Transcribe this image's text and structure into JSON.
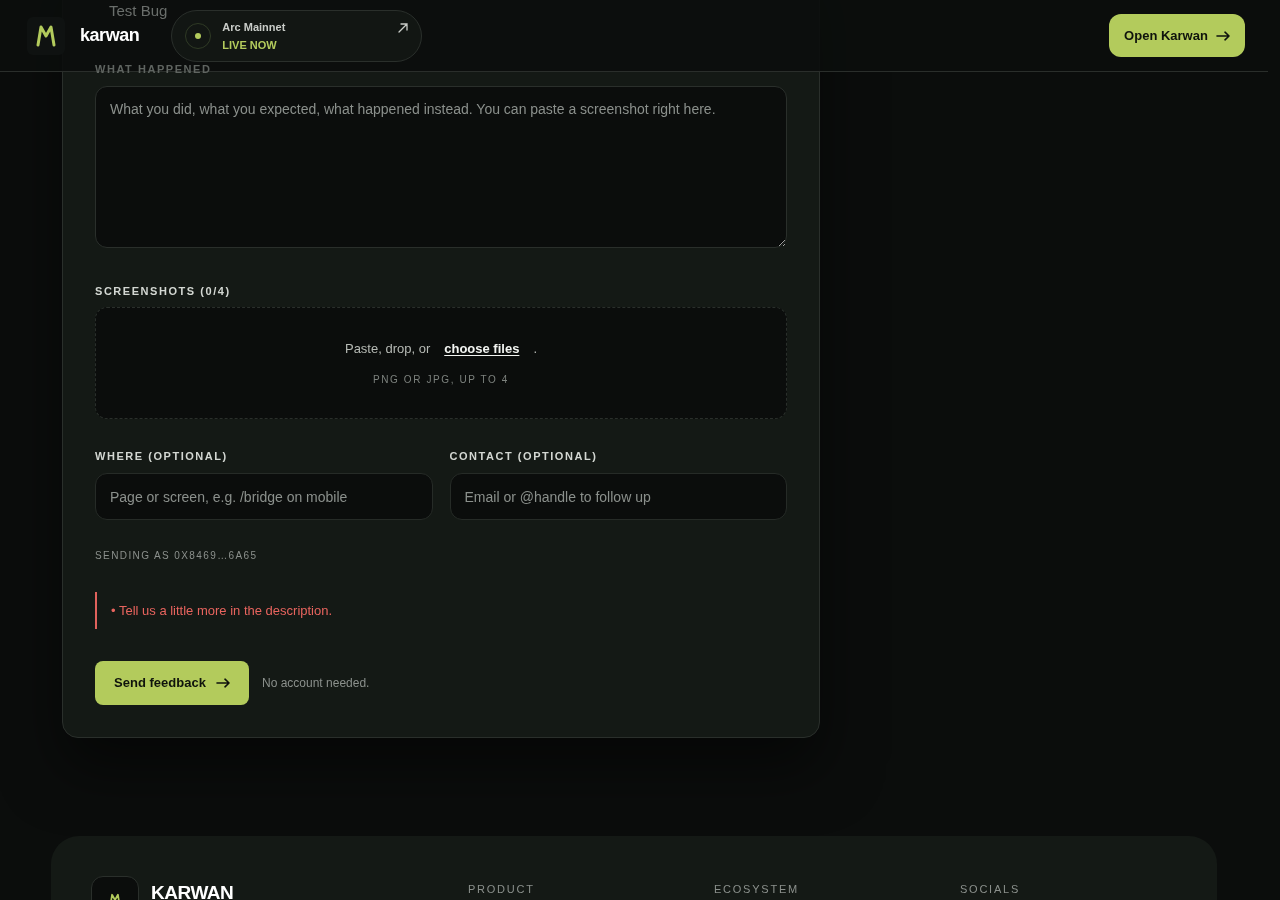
{
  "header": {
    "brand": "karwan",
    "network": {
      "name": "Arc Mainnet",
      "status": "LIVE NOW"
    },
    "cta": "Open Karwan"
  },
  "form": {
    "title_field": {
      "value": "Test Bug"
    },
    "description": {
      "label": "WHAT HAPPENED",
      "placeholder": "What you did, what you expected, what happened instead. You can paste a screenshot right here."
    },
    "screenshots": {
      "label": "SCREENSHOTS (0/4)",
      "prompt": "Paste, drop, or",
      "link": "choose files",
      "period": ".",
      "hint": "PNG OR JPG, UP TO 4"
    },
    "fields": [
      {
        "label": "WHERE (OPTIONAL)",
        "placeholder": "Page or screen, e.g. /bridge on mobile"
      },
      {
        "label": "CONTACT (OPTIONAL)",
        "placeholder": "Email or @handle to follow up"
      }
    ],
    "sender": "SENDING AS 0X8469…6A65",
    "errors": [
      "• Tell us a little more in the description."
    ],
    "submit": "Send feedback",
    "note": "No account needed."
  },
  "footer": {
    "brand": "KARWAN",
    "columns": [
      {
        "heading": "PRODUCT"
      },
      {
        "heading": "ECOSYSTEM"
      },
      {
        "heading": "SOCIALS"
      }
    ]
  }
}
